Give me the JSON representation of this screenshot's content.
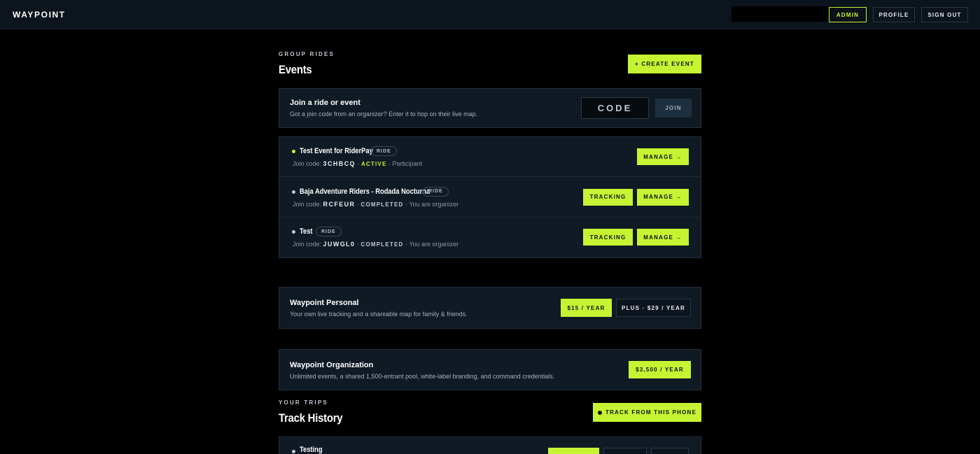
{
  "header": {
    "brand": "WAYPOINT",
    "nav": {
      "admin": "ADMIN",
      "profile": "PROFILE",
      "sign_out": "SIGN OUT"
    }
  },
  "events_section": {
    "kicker": "GROUP RIDES",
    "title": "Events",
    "create_button": "+ CREATE EVENT"
  },
  "join": {
    "title": "Join a ride or event",
    "subtitle": "Got a join code from an organizer? Enter it to hop on their live map.",
    "code_placeholder": "CODE",
    "join_button": "JOIN"
  },
  "events": [
    {
      "name": "Test Event for RiderPay",
      "tag": "RIDE",
      "code_label": "Join code:",
      "code": "3CHBCQ",
      "status": "ACTIVE",
      "role": "Participant",
      "tracking_label": "",
      "manage_label": "MANAGE →"
    },
    {
      "name": "Baja Adventure Riders - Rodada Nocturna",
      "tag": "RIDE",
      "code_label": "Join code:",
      "code": "RCFEUR",
      "status": "COMPLETED",
      "role": "You are organizer",
      "tracking_label": "TRACKING",
      "manage_label": "MANAGE →"
    },
    {
      "name": "Test",
      "tag": "RIDE",
      "code_label": "Join code:",
      "code": "JUWGL0",
      "status": "COMPLETED",
      "role": "You are organizer",
      "tracking_label": "TRACKING",
      "manage_label": "MANAGE →"
    }
  ],
  "personal_plan": {
    "title": "Waypoint Personal",
    "subtitle": "Your own live tracking and a shareable map for family & friends.",
    "price_button": "$15 / YEAR",
    "plus_button": "PLUS · $29 / YEAR"
  },
  "org_plan": {
    "title": "Waypoint Organization",
    "subtitle": "Unlimited events, a shared 1,500-entrant pool, white-label branding, and command credentials.",
    "price_button": "$3,500 / YEAR"
  },
  "trips_section": {
    "kicker": "YOUR TRIPS",
    "title": "Track History",
    "track_button": "TRACK FROM THIS PHONE"
  },
  "trips": [
    {
      "name": "Testing"
    }
  ],
  "colors": {
    "accent": "#c6f432",
    "background": "#000000",
    "card": "#0f1a25",
    "active_status": "#c6f432",
    "completed_status": "#c2cad4"
  }
}
